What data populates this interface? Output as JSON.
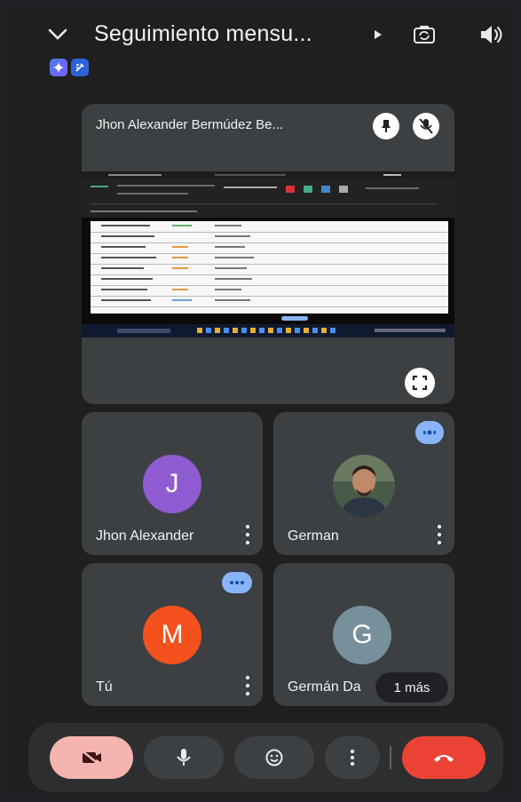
{
  "header": {
    "title": "Seguimiento mensu...",
    "icons": [
      "chevron-down-icon",
      "play-arrow-icon",
      "switch-camera-icon",
      "speaker-icon"
    ],
    "badges": [
      "gemini-sparkle-icon",
      "notes-icon"
    ]
  },
  "presenter": {
    "name": "Jhon Alexander Bermúdez Be...",
    "icons": [
      "pin-icon",
      "mic-off-icon",
      "fullscreen-icon"
    ]
  },
  "participants": [
    {
      "name": "Jhon Alexander",
      "initial": "J",
      "avatar_color": "#8e5bd0"
    },
    {
      "name": "German",
      "initial": "",
      "avatar_color": "#3b4b3e",
      "speaking": true
    },
    {
      "name": "Tú",
      "initial": "M",
      "avatar_color": "#f4511e"
    },
    {
      "name": "Germán Da",
      "initial": "G",
      "avatar_color": "#78909c"
    }
  ],
  "more_chip": "1 más",
  "controls": [
    "camera-off-button",
    "mic-button",
    "reactions-button",
    "more-options-button",
    "end-call-button"
  ],
  "colors": {
    "end_call": "#ea4335",
    "camera_off": "#f4b4b0",
    "accent_blue": "#8ab4f8"
  }
}
